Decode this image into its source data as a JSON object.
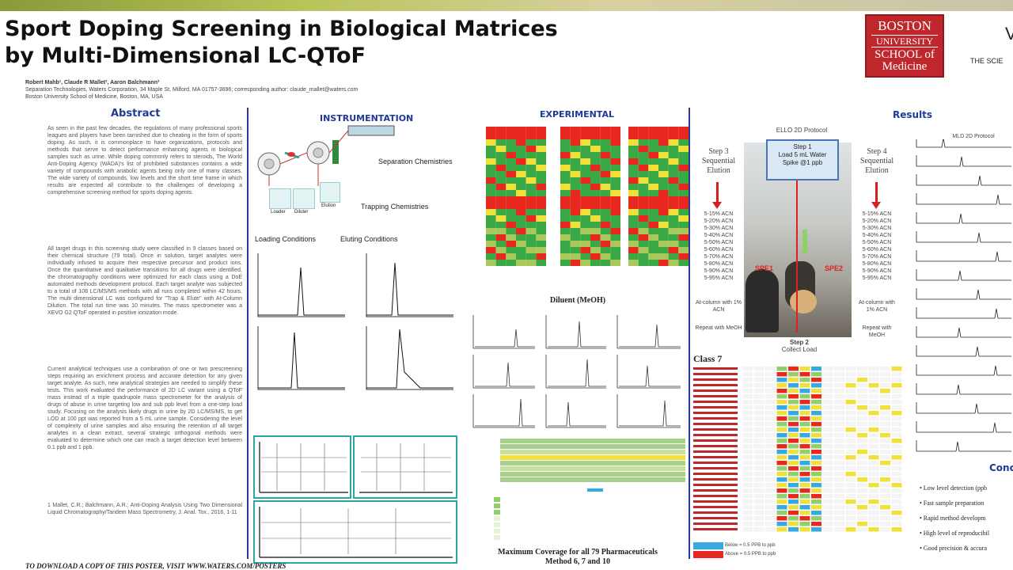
{
  "poster": {
    "title_line1": "Sport Doping Screening in Biological Matrices",
    "title_line2": "by Multi-Dimensional LC-QToF",
    "authors_line1": "Robert Mahb¹, Claude R Mallet², Aaron Balchmann³",
    "authors_line2": "Separation Technologies, Waters Corporation, 34 Maple St, Milford, MA 01757-3696; corresponding author: claude_mallet@waters.com",
    "authors_line3": "Boston University School of Medicine, Boston, MA, USA",
    "footer": "TO DOWNLOAD A COPY OF THIS POSTER, VISIT WWW.WATERS.COM/POSTERS"
  },
  "logo": {
    "line1": "BOSTON",
    "line2": "UNIVERSITY",
    "line3": "SCHOOL of",
    "line4": "Medicine"
  },
  "edge": {
    "top": "V",
    "sub": "THE SCIE"
  },
  "sections": {
    "abstract": "Abstract",
    "instrumentation": "INSTRUMENTATION",
    "experimental": "EXPERIMENTAL",
    "results": "Results"
  },
  "abstract": {
    "p1": "As seen in the past few decades, the regulations of many professional sports leagues and players have been tarnished due to cheating in the form of sports doping. As such, it is commonplace to have organizations, protocols and methods that serve to detect performance enhancing agents in biological samples such as urine. While doping commonly refers to steroids, The World Anti-Doping Agency (WADA)'s list of prohibited substances contains a wide variety of compounds with anabolic agents being only one of many classes. The wide variety of compounds, low levels and the short time frame in which results are expected all contribute to the challenges of developing a comprehensive screening method for sports doping agents.",
    "p2": "All target drugs in this screening study were classified in 9 classes based on their chemical structure (79 total). Once in solution, target analytes were individually infused to acquire their respective precursor and product ions. Once the quantitative and qualitative transitions for all drugs were identified, the chromatography conditions were optimized for each class using a DoE automated methods development protocol. Each target analyte was subjected to a total of 108 LC/MS/MS methods with all runs completed within 42 hours. The multi dimensional LC was configured for \"Trap & Elute\" with At-Column Dilution. The total run time was 10 minutes. The mass spectrometer was a XEVO G2 QToF operated in positive ionization mode.",
    "p3": "Current analytical techniques use a combination of one or two prescreening steps requiring an enrichment process and accurate detection for any given target analyte. As such, new analytical strategies are needed to simplify these tests. This work evaluated the performance of 2D LC variant using a QToF mass instead of a triple quadrupole mass spectrometer for the analysis of drugs of abuse in urine targeting low and sub ppb level from a one-step load study. Focusing on the analysis likely drugs in urine by 2D LC/MS/MS, to get LOD at 100 ppt was reported from a 5 mL urine sample. Considering the level of complexity of urine samples and also ensuring the retention of all target analytes in a clean extract, several strategic orthogonal methods were evaluated to determine which one can reach a target detection level between 0.1 ppb and 1 ppb.",
    "ref": "1 Mallet, C.R.; Balchmann, A.R.; Anti-Doping Analysis Using Two Dimensional Liquid Chromatography/Tandem Mass Spectrometry, J. Anal. Tox., 2016, 1-11"
  },
  "instrumentation": {
    "separation": "Separation Chemistries",
    "trapping": "Trapping Chemistries",
    "loading": "Loading Conditions",
    "eluting": "Eluting Conditions",
    "box1": "Loader",
    "box2": "Diluter",
    "box3": "Elution"
  },
  "experimental": {
    "dmso_caption": "Diluent (MeOH)",
    "coverage_line1": "Maximum Coverage for all 79 Pharmaceuticals",
    "coverage_line2": "Method 6, 7 and 10"
  },
  "results": {
    "protocol_top": "ELLO 2D Protocol",
    "step1": "Step 1",
    "step1_a": "Load 5 mL Water",
    "step1_b": "Spike @1 ppb",
    "step3": "Step 3",
    "step3_sub": "Sequential",
    "step3_sub2": "Elution",
    "step4": "Step 4",
    "step4_sub": "Sequential",
    "step4_sub2": "Elution",
    "step2": "Step 2",
    "step2_sub": "Collect Load",
    "class7": "Class 7",
    "spe1": "SPE1",
    "spe2": "SPE2",
    "protocol_right": "MLD 2D Protocol",
    "left_list": [
      "5-15% ACN",
      "5-20% ACN",
      "5-30% ACN",
      "5-40% ACN",
      "5-50% ACN",
      "5-60% ACN",
      "5-70% ACN",
      "5-80% ACN",
      "5-90% ACN",
      "5-95% ACN"
    ],
    "right_list": [
      "5-15% ACN",
      "5-20% ACN",
      "5-30% ACN",
      "5-40% ACN",
      "5-50% ACN",
      "5-60% ACN",
      "5-70% ACN",
      "5-80% ACN",
      "5-90% ACN",
      "5-95% ACN"
    ],
    "left_note": "At-column with 1% ACN",
    "right_note": "At-column with 1% ACN",
    "left_repeat": "Repeat with MeOH",
    "right_repeat": "Repeat with MeOH",
    "legend1": "Below = 0.5 PPB to ppb",
    "legend2": "Above = 0.5 PPB to ppb"
  },
  "conclusions": {
    "head": "Conc",
    "items": [
      "Low level detection (ppb",
      "Fast sample preparation",
      "Rapid method developm",
      "High level of reproducibil",
      "Good precision & accura"
    ]
  },
  "colors": {
    "accent_blue": "#1e3a96",
    "heat_red": "#e8281e",
    "heat_green": "#3aa845",
    "heat_yellow": "#f0e03a",
    "logo_red": "#c0272d"
  }
}
